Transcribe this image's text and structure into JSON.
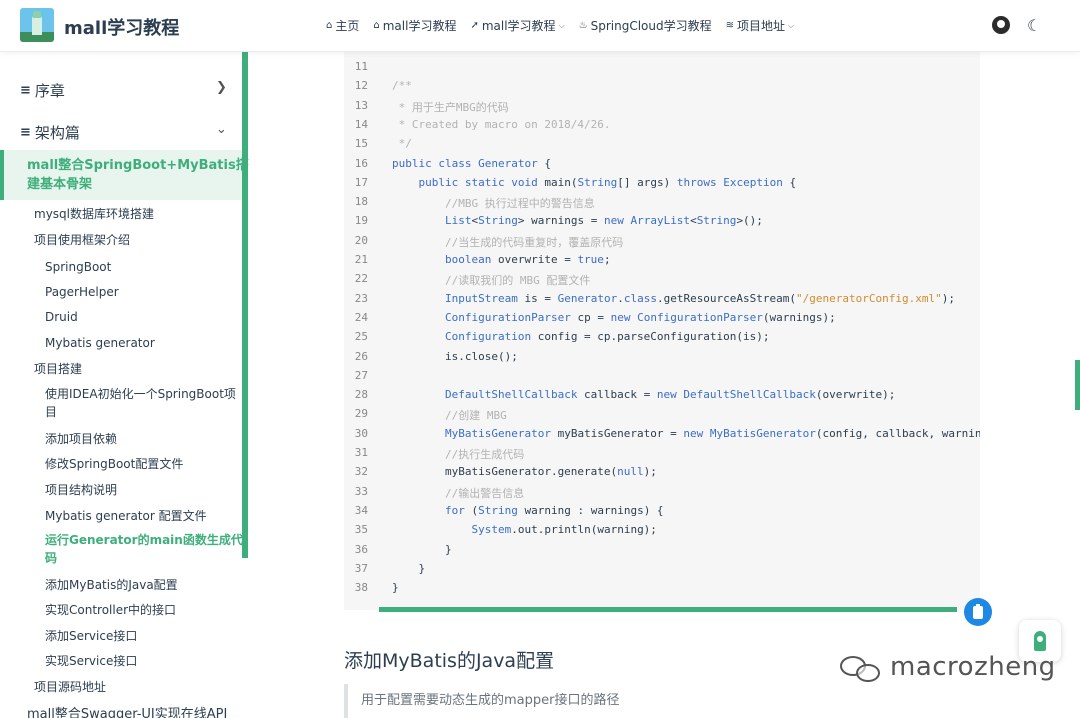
{
  "navbar": {
    "site_title": "mall学习教程",
    "links": [
      {
        "icon": "home-icon",
        "glyph": "⌂",
        "label": "主页",
        "has_dropdown": false
      },
      {
        "icon": "home-icon",
        "glyph": "⌂",
        "label": "mall学习教程",
        "has_dropdown": false
      },
      {
        "icon": "rocket-icon",
        "glyph": "➚",
        "label": "mall学习教程",
        "has_dropdown": true
      },
      {
        "icon": "fire-icon",
        "glyph": "♨",
        "label": "SpringCloud学习教程",
        "has_dropdown": false
      },
      {
        "icon": "layers-icon",
        "glyph": "≋",
        "label": "项目地址",
        "has_dropdown": true
      }
    ],
    "right_icons": [
      "github-icon",
      "language-icon"
    ]
  },
  "sidebar": {
    "groups": [
      {
        "label": "序章",
        "icon": "book-icon",
        "expanded": false
      },
      {
        "label": "架构篇",
        "icon": "book-icon",
        "expanded": true
      }
    ],
    "active_page": "mall整合SpringBoot+MyBatis搭建基本骨架",
    "active_page_lines": [
      "mall整合SpringBoot+MyBatis搭",
      "建基本骨架"
    ],
    "items": [
      {
        "label": "mysql数据库环境搭建",
        "level": 2
      },
      {
        "label": "项目使用框架介绍",
        "level": 2
      },
      {
        "label": "SpringBoot",
        "level": 3
      },
      {
        "label": "PagerHelper",
        "level": 3
      },
      {
        "label": "Druid",
        "level": 3
      },
      {
        "label": "Mybatis generator",
        "level": 3
      },
      {
        "label": "项目搭建",
        "level": 2
      },
      {
        "label": "使用IDEA初始化一个SpringBoot项",
        "label2": "目",
        "level": 3
      },
      {
        "label": "添加项目依赖",
        "level": 3
      },
      {
        "label": "修改SpringBoot配置文件",
        "level": 3
      },
      {
        "label": "项目结构说明",
        "level": 3
      },
      {
        "label": "Mybatis generator 配置文件",
        "level": 3
      },
      {
        "label": "运行Generator的main函数生成代",
        "label2": "码",
        "level": 3,
        "active": true
      },
      {
        "label": "添加MyBatis的Java配置",
        "level": 3
      },
      {
        "label": "实现Controller中的接口",
        "level": 3
      },
      {
        "label": "添加Service接口",
        "level": 3
      },
      {
        "label": "实现Service接口",
        "level": 3
      },
      {
        "label": "项目源码地址",
        "level": 2
      },
      {
        "label": "mall整合Swagger-UI实现在线API",
        "level": 1
      }
    ]
  },
  "code": {
    "language": "java",
    "lines": [
      {
        "n": "11",
        "t": ""
      },
      {
        "n": "12",
        "t": "/**"
      },
      {
        "n": "13",
        "t": " * 用于生产MBG的代码"
      },
      {
        "n": "14",
        "t": " * Created by macro on 2018/4/26."
      },
      {
        "n": "15",
        "t": " */"
      },
      {
        "n": "16",
        "t": "public class Generator {"
      },
      {
        "n": "17",
        "t": "    public static void main(String[] args) throws Exception {"
      },
      {
        "n": "18",
        "t": "        //MBG 执行过程中的警告信息"
      },
      {
        "n": "19",
        "t": "        List<String> warnings = new ArrayList<String>();"
      },
      {
        "n": "20",
        "t": "        //当生成的代码重复时，覆盖原代码"
      },
      {
        "n": "21",
        "t": "        boolean overwrite = true;"
      },
      {
        "n": "22",
        "t": "        //读取我们的 MBG 配置文件"
      },
      {
        "n": "23",
        "t": "        InputStream is = Generator.class.getResourceAsStream(\"/generatorConfig.xml\");"
      },
      {
        "n": "24",
        "t": "        ConfigurationParser cp = new ConfigurationParser(warnings);"
      },
      {
        "n": "25",
        "t": "        Configuration config = cp.parseConfiguration(is);"
      },
      {
        "n": "26",
        "t": "        is.close();"
      },
      {
        "n": "27",
        "t": ""
      },
      {
        "n": "28",
        "t": "        DefaultShellCallback callback = new DefaultShellCallback(overwrite);"
      },
      {
        "n": "29",
        "t": "        //创建 MBG"
      },
      {
        "n": "30",
        "t": "        MyBatisGenerator myBatisGenerator = new MyBatisGenerator(config, callback, warnings);"
      },
      {
        "n": "31",
        "t": "        //执行生成代码"
      },
      {
        "n": "32",
        "t": "        myBatisGenerator.generate(null);"
      },
      {
        "n": "33",
        "t": "        //输出警告信息"
      },
      {
        "n": "34",
        "t": "        for (String warning : warnings) {"
      },
      {
        "n": "35",
        "t": "            System.out.println(warning);"
      },
      {
        "n": "36",
        "t": "        }"
      },
      {
        "n": "37",
        "t": "    }"
      },
      {
        "n": "38",
        "t": "}"
      }
    ]
  },
  "content": {
    "section_title": "添加MyBatis的Java配置",
    "quote": "用于配置需要动态生成的mapper接口的路径"
  },
  "watermark": "macrozheng",
  "colors": {
    "accent": "#3eaf7c",
    "text": "#2c3e50",
    "code_bg": "#f6f6f6",
    "keyword": "#3e6ac6",
    "comment": "#b2b2b2",
    "string": "#d08c2e",
    "copy_button": "#1e88e5"
  }
}
